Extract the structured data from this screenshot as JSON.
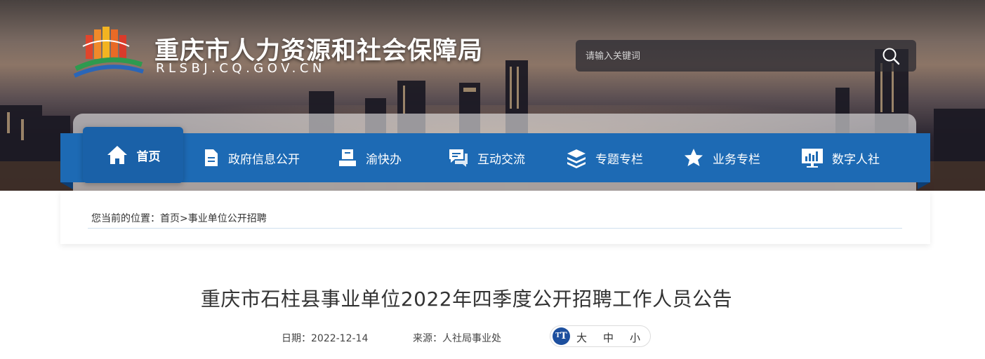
{
  "header": {
    "site_title": "重庆市人力资源和社会保障局",
    "site_domain": "RLSBJ.CQ.GOV.CN",
    "search": {
      "placeholder": "请输入关键词"
    }
  },
  "nav": {
    "items": [
      {
        "label": "首页",
        "icon": "home-icon",
        "active": true
      },
      {
        "label": "政府信息公开",
        "icon": "document-icon"
      },
      {
        "label": "渝快办",
        "icon": "service-desk-icon"
      },
      {
        "label": "互动交流",
        "icon": "chat-icon"
      },
      {
        "label": "专题专栏",
        "icon": "layers-icon"
      },
      {
        "label": "业务专栏",
        "icon": "star-icon"
      },
      {
        "label": "数字人社",
        "icon": "monitor-chart-icon"
      }
    ]
  },
  "breadcrumb": {
    "prefix": "您当前的位置：",
    "home": "首页",
    "separator": ">",
    "current": "事业单位公开招聘"
  },
  "article": {
    "title": "重庆市石柱县事业单位2022年四季度公开招聘工作人员公告",
    "date_label": "日期：",
    "date": "2022-12-14",
    "source_label": "来源：",
    "source": "人社局事业处",
    "font_size": {
      "icon": "T",
      "large": "大",
      "medium": "中",
      "small": "小"
    }
  },
  "colors": {
    "nav_blue": "#1d6ab4",
    "accent": "#1d4f9e"
  }
}
